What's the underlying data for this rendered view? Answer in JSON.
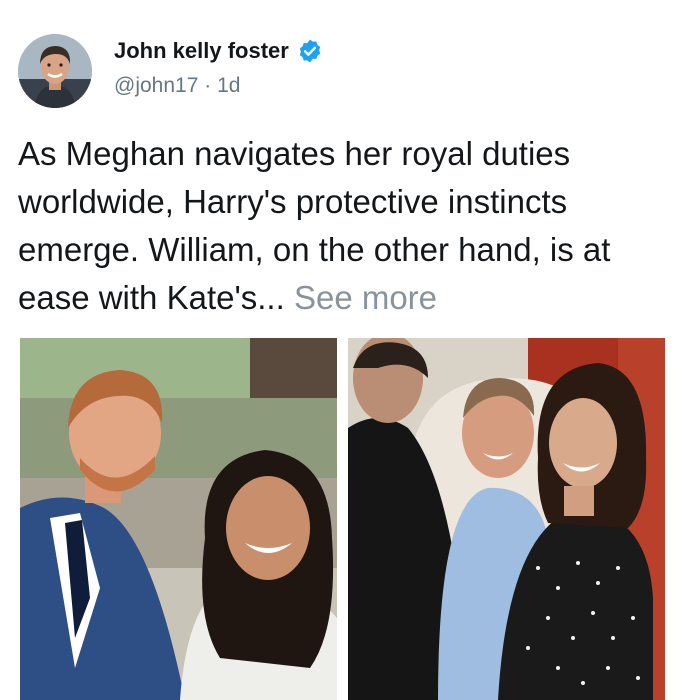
{
  "tweet": {
    "author_name": "John kelly foster",
    "handle": "@john17",
    "separator": "·",
    "age": "1d",
    "text": "As Meghan navigates her royal duties worldwide, Harry's protective instincts emerge. William, on the other hand, is at ease with Kate's...",
    "see_more": "See more"
  },
  "icons": {
    "verified": "verified-badge-icon"
  },
  "colors": {
    "verified": "#1da1f2",
    "text": "#14171a",
    "secondary": "#657786",
    "see_more": "#8a939b"
  }
}
